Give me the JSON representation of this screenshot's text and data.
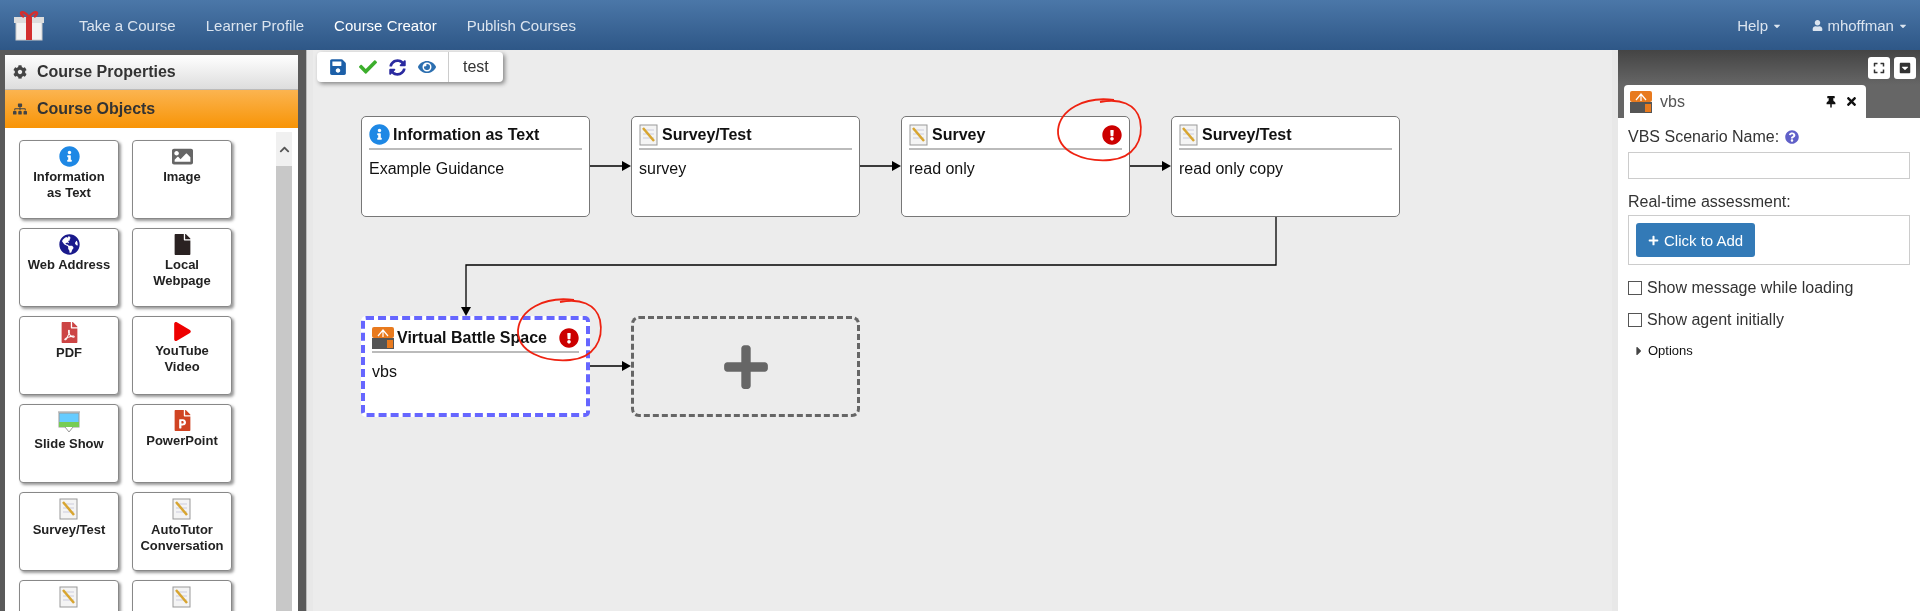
{
  "nav": {
    "items": [
      {
        "label": "Take a Course",
        "selected": false
      },
      {
        "label": "Learner Profile",
        "selected": false
      },
      {
        "label": "Course Creator",
        "selected": true
      },
      {
        "label": "Publish Courses",
        "selected": false
      }
    ],
    "help": "Help",
    "user": "mhoffman"
  },
  "sidebar": {
    "sections": [
      {
        "label": "Course Properties",
        "kind": "properties",
        "selected": false
      },
      {
        "label": "Course Objects",
        "kind": "objects",
        "selected": true
      }
    ],
    "objects": [
      {
        "kind": "info",
        "label": "Information as Text"
      },
      {
        "kind": "image",
        "label": "Image"
      },
      {
        "kind": "web",
        "label": "Web Address"
      },
      {
        "kind": "file",
        "label": "Local Webpage"
      },
      {
        "kind": "pdf",
        "label": "PDF"
      },
      {
        "kind": "video",
        "label": "YouTube Video"
      },
      {
        "kind": "slides",
        "label": "Slide Show"
      },
      {
        "kind": "ppt",
        "label": "PowerPoint"
      },
      {
        "kind": "survey",
        "label": "Survey/Test"
      },
      {
        "kind": "survey",
        "label": "AutoTutor Conversation"
      },
      {
        "kind": "survey"
      },
      {
        "kind": "survey"
      }
    ]
  },
  "toolbar": {
    "course_name": "test"
  },
  "nodes": [
    {
      "kind": "info",
      "title": "Information as Text",
      "body": "Example Guidance",
      "warning": false,
      "selected": false,
      "circled": false
    },
    {
      "kind": "survey",
      "title": "Survey/Test",
      "body": "survey",
      "warning": false,
      "selected": false,
      "circled": false
    },
    {
      "kind": "survey",
      "title": "Survey",
      "body": "read only",
      "warning": true,
      "selected": false,
      "circled": true
    },
    {
      "kind": "survey",
      "title": "Survey/Test",
      "body": "read only copy",
      "warning": false,
      "selected": false,
      "circled": false
    },
    {
      "kind": "vbs",
      "title": "Virtual Battle Space",
      "body": "vbs",
      "warning": true,
      "selected": true,
      "circled": true
    }
  ],
  "panel": {
    "tab": {
      "kind": "vbs",
      "title": "vbs"
    },
    "scenario_label": "VBS Scenario Name:",
    "assessment_label": "Real-time assessment:",
    "add_button": "Click to Add",
    "checkboxes": [
      {
        "label": "Show message while loading",
        "checked": false
      },
      {
        "label": "Show agent initially",
        "checked": false
      }
    ],
    "options": {
      "label": "Options",
      "expanded": false
    }
  }
}
